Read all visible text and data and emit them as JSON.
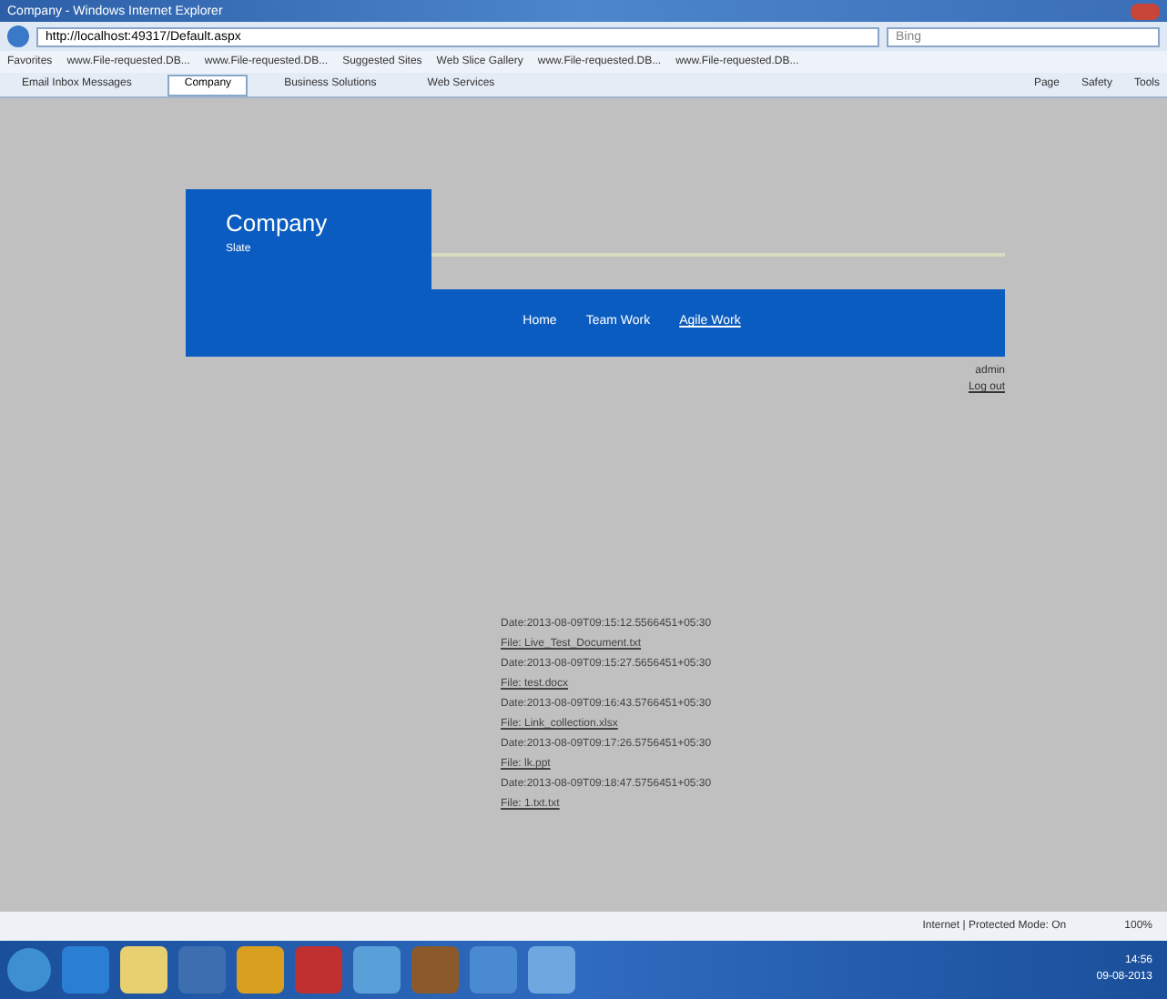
{
  "window": {
    "title": "Company - Windows Internet Explorer"
  },
  "address_bar": {
    "url": "http://localhost:49317/Default.aspx",
    "search_placeholder": "Bing"
  },
  "favorites_bar": {
    "label": "Favorites",
    "items": [
      "www.File-requested.DB...",
      "www.File-requested.DB...",
      "Suggested Sites",
      "Web Slice Gallery",
      "www.File-requested.DB...",
      "www.File-requested.DB..."
    ]
  },
  "tabs": [
    {
      "label": "Email Inbox Messages",
      "selected": false
    },
    {
      "label": "Company",
      "selected": true
    },
    {
      "label": "Business Solutions",
      "selected": false
    },
    {
      "label": "Web Services",
      "selected": false
    }
  ],
  "command_bar": [
    "Page",
    "Safety",
    "Tools"
  ],
  "site": {
    "brand": "Company",
    "tagline": "Slate",
    "nav": [
      {
        "label": "Home",
        "selected": false
      },
      {
        "label": "Team Work",
        "selected": false
      },
      {
        "label": "Agile Work",
        "selected": true
      }
    ],
    "user": "admin",
    "logout": "Log out"
  },
  "entries": [
    {
      "date": "Date:2013-08-09T09:15:12.5566451+05:30",
      "file": "File: Live_Test_Document.txt"
    },
    {
      "date": "Date:2013-08-09T09:15:27.5656451+05:30",
      "file": "File: test.docx"
    },
    {
      "date": "Date:2013-08-09T09:16:43.5766451+05:30",
      "file": "File: Link_collection.xlsx"
    },
    {
      "date": "Date:2013-08-09T09:17:26.5756451+05:30",
      "file": "File: lk.ppt"
    },
    {
      "date": "Date:2013-08-09T09:18:47.5756451+05:30",
      "file": "File: 1.txt.txt"
    }
  ],
  "status_bar": {
    "zone": "Internet | Protected Mode: On",
    "zoom": "100%"
  },
  "taskbar": {
    "clock_time": "14:56",
    "clock_date": "09-08-2013"
  }
}
